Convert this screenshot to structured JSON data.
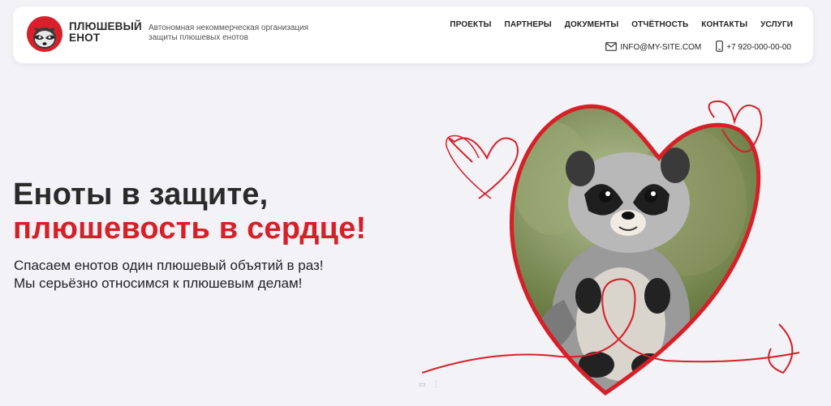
{
  "brand": {
    "name_line1": "ПЛЮШЕВЫЙ",
    "name_line2": "ЕНОТ",
    "tagline": "Автономная некоммерческая организация защиты плюшевых енотов"
  },
  "nav": [
    "ПРОЕКТЫ",
    "ПАРТНЕРЫ",
    "ДОКУМЕНТЫ",
    "ОТЧЁТНОСТЬ",
    "КОНТАКТЫ",
    "УСЛУГИ"
  ],
  "contacts": {
    "email": "INFO@MY-SITE.COM",
    "phone": "+7 920-000-00-00"
  },
  "hero": {
    "title_line1": "Еноты в защите,",
    "title_line2": "плюшевость в сердце!",
    "subtitle_line1": "Спасаем енотов один плюшевый объятий в раз!",
    "subtitle_line2": "Мы серьёзно относимся к плюшевым делам!"
  },
  "colors": {
    "accent": "#d71f27",
    "background": "#f3f2f7",
    "header_bg": "#ffffff"
  },
  "icons": {
    "email": "envelope-icon",
    "phone": "phone-icon"
  }
}
